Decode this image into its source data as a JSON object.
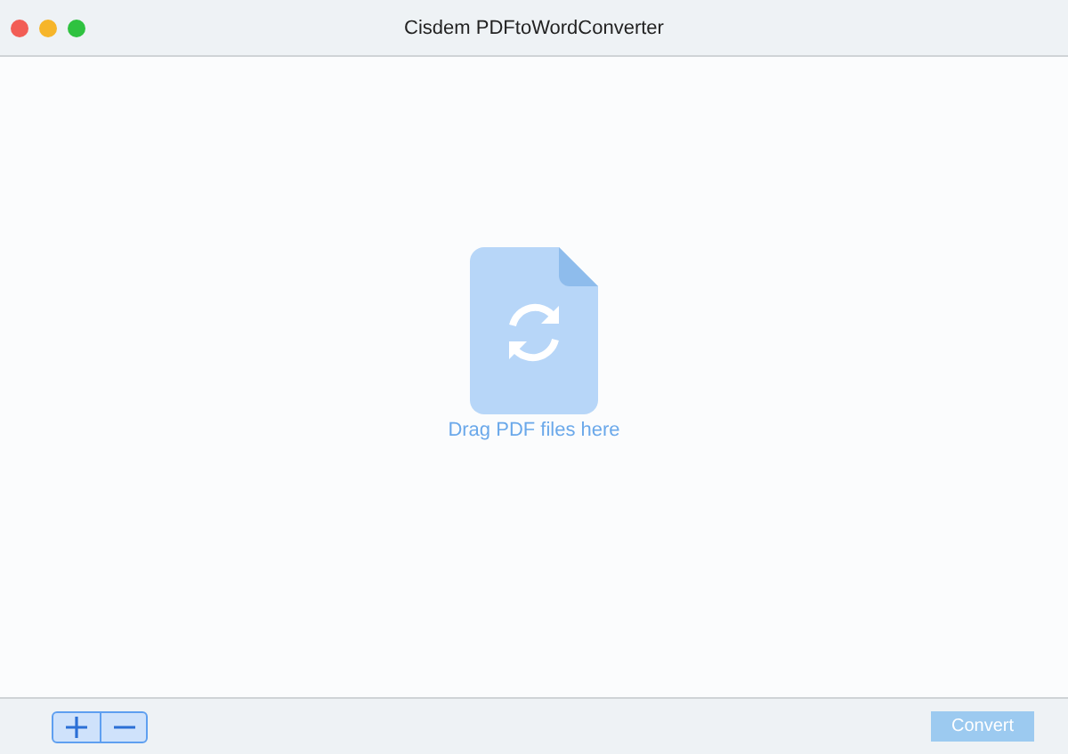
{
  "window": {
    "title": "Cisdem PDFtoWordConverter"
  },
  "drop_area": {
    "hint": "Drag PDF files here"
  },
  "footer": {
    "convert_button": {
      "label": "Convert",
      "disabled": true
    }
  }
}
